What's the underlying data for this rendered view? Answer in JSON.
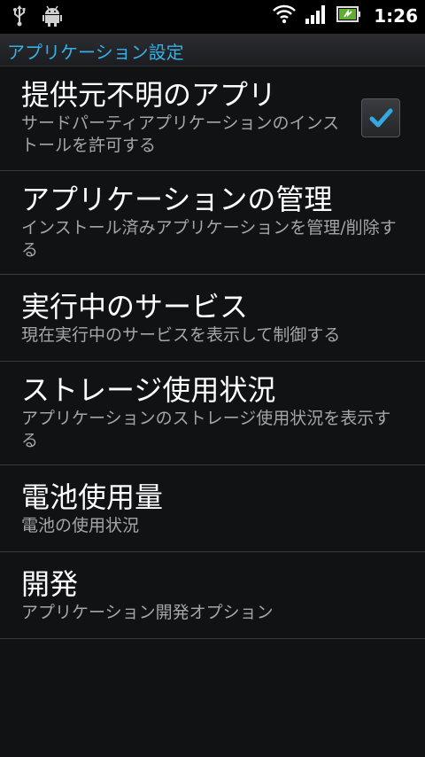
{
  "status_bar": {
    "time": "1:26",
    "left_icons": [
      "usb-icon",
      "android-debug-icon"
    ],
    "right_icons": [
      "wifi-icon",
      "signal-icon",
      "battery-icon"
    ]
  },
  "title_bar": {
    "title": "アプリケーション設定",
    "color": "#35b0e6"
  },
  "settings": [
    {
      "title": "提供元不明のアプリ",
      "summary": "サードパーティアプリケーションのインストールを許可する",
      "checkbox": true,
      "checked": true
    },
    {
      "title": "アプリケーションの管理",
      "summary": "インストール済みアプリケーションを管理/削除する"
    },
    {
      "title": "実行中のサービス",
      "summary": "現在実行中のサービスを表示して制御する"
    },
    {
      "title": "ストレージ使用状況",
      "summary": "アプリケーションのストレージ使用状況を表示する"
    },
    {
      "title": "電池使用量",
      "summary": "電池の使用状況"
    },
    {
      "title": "開発",
      "summary": "アプリケーション開発オプション"
    }
  ]
}
